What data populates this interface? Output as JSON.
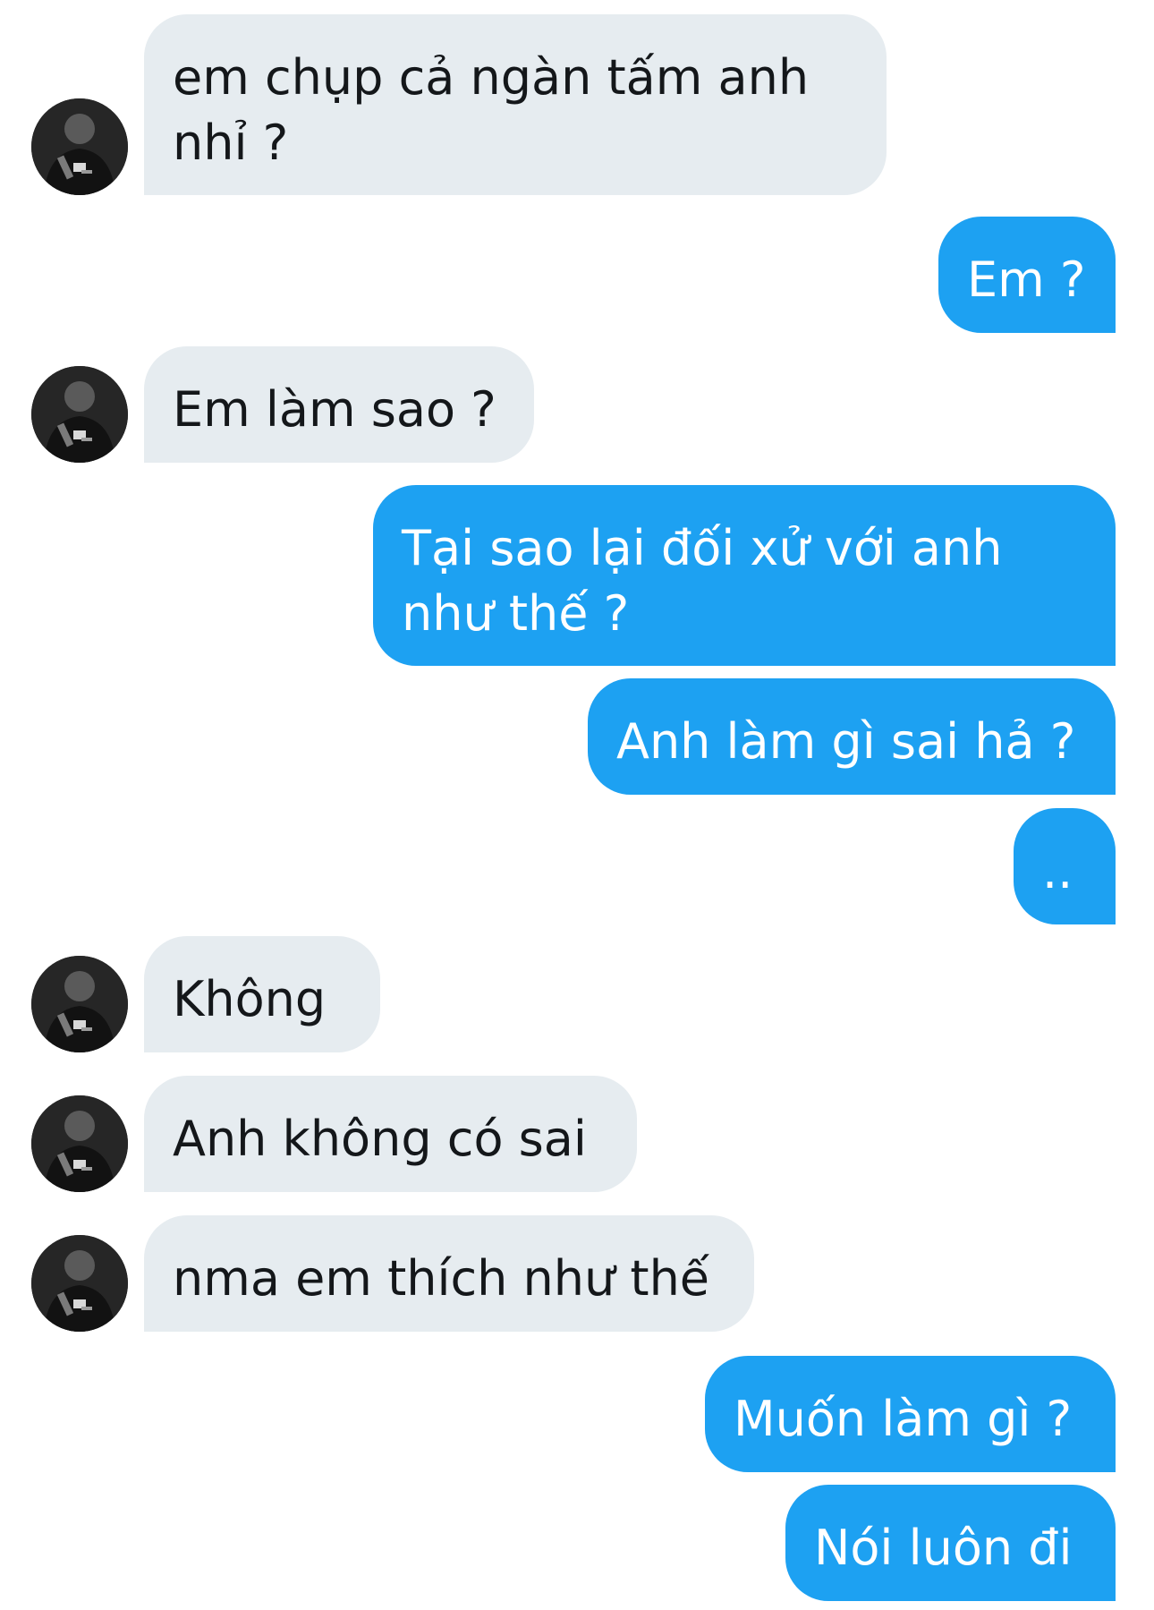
{
  "conversation": {
    "messages": [
      {
        "from": "other",
        "text": "em chụp cả ngàn tấm anh\nnhỉ ?"
      },
      {
        "from": "me",
        "text": "Em ?"
      },
      {
        "from": "other",
        "text": "Em làm sao ?"
      },
      {
        "from": "me",
        "text": "Tại sao lại đối xử với anh\nnhư thế ?"
      },
      {
        "from": "me",
        "text": "Anh làm gì sai hả ?"
      },
      {
        "from": "me",
        "text": ".."
      },
      {
        "from": "other",
        "text": "Không"
      },
      {
        "from": "other",
        "text": "Anh không có sai"
      },
      {
        "from": "other",
        "text": "nma em thích như thế"
      },
      {
        "from": "me",
        "text": "Muốn làm gì ?"
      },
      {
        "from": "me",
        "text": "Nói luôn đi"
      }
    ]
  },
  "colors": {
    "sent_bubble": "#1da1f2",
    "received_bubble": "#e6ecf0",
    "sent_text": "#ffffff",
    "received_text": "#14171a"
  },
  "icons": {
    "avatar": "contact-avatar-photo"
  }
}
